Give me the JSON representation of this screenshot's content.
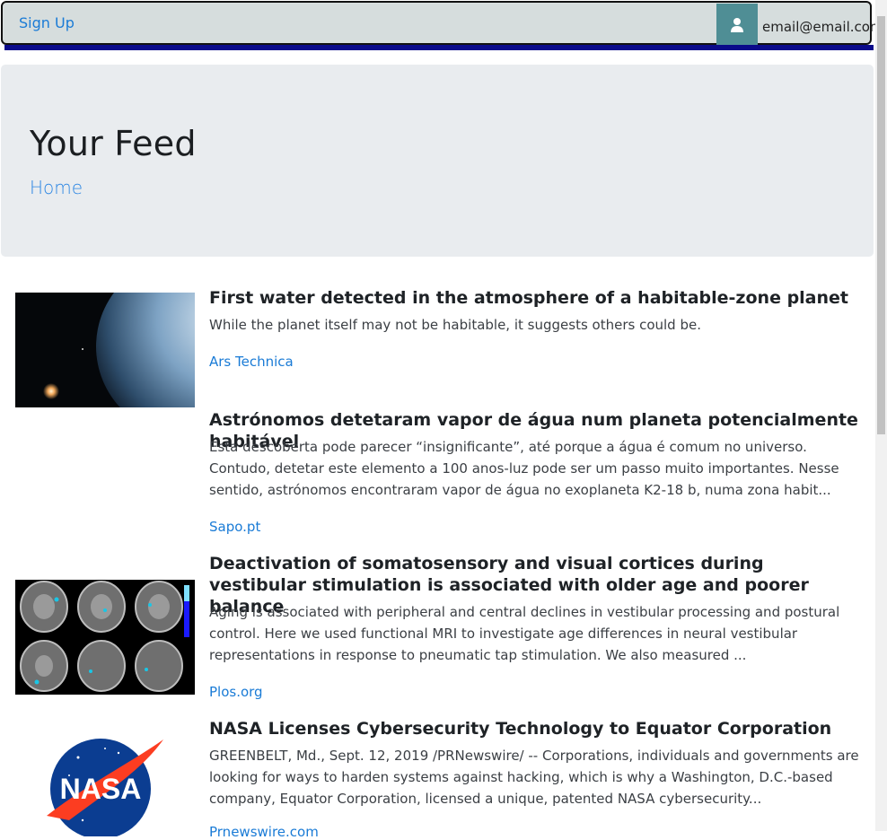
{
  "nav": {
    "signup_label": "Sign Up",
    "user_email": "email@email.com"
  },
  "header": {
    "title": "Your Feed",
    "breadcrumb": "Home"
  },
  "articles": [
    {
      "title": "First water detected in the atmosphere of a habitable-zone planet",
      "description": "While the planet itself may not be habitable, it suggests others could be.",
      "source": "Ars Technica",
      "thumbnail": "planet-image"
    },
    {
      "title": "Astrónomos detetaram vapor de água num planeta potencialmente habitável",
      "description": "Esta descoberta pode parecer “insignificante”, até porque a água é comum no universo. Contudo, detetar este elemento a 100 anos-luz pode ser um passo muito importantes. Nesse sentido, astrónomos encontraram vapor de água no exoplaneta K2-18 b, numa zona habit...",
      "source": "Sapo.pt",
      "thumbnail": null
    },
    {
      "title": "Deactivation of somatosensory and visual cortices during vestibular stimulation is associated with older age and poorer balance",
      "description": "Aging is associated with peripheral and central declines in vestibular processing and postural control. Here we used functional MRI to investigate age differences in neural vestibular representations in response to pneumatic tap stimulation. We also measured ...",
      "source": "Plos.org",
      "thumbnail": "brain-mri-image"
    },
    {
      "title": "NASA Licenses Cybersecurity Technology to Equator Corporation",
      "description": "GREENBELT, Md., Sept. 12, 2019 /PRNewswire/ -- Corporations, individuals and governments are looking for ways to harden systems against hacking, which is why a Washington, D.C.-based company, Equator Corporation, licensed a unique, patented NASA cybersecurity...",
      "source": "Prnewswire.com",
      "thumbnail": "nasa-logo-image",
      "logo_text": "NASA"
    }
  ],
  "colors": {
    "link": "#1a7bd6",
    "navbar_bg": "#d6dddd",
    "user_box": "#4f8e95",
    "jumbo_bg": "#e9ecef"
  }
}
